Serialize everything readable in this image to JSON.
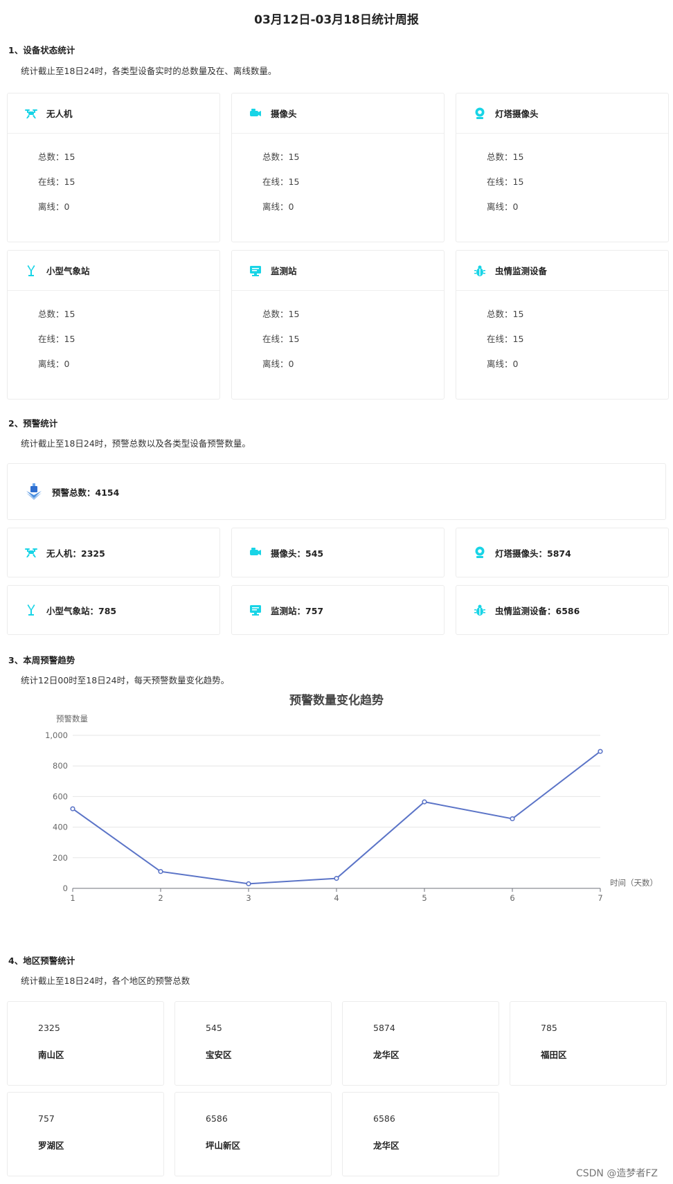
{
  "title": "03月12日-03月18日统计周报",
  "section1": {
    "heading": "1、设备状态统计",
    "desc": "统计截止至18日24时，各类型设备实时的总数量及在、离线数量。",
    "devices": [
      {
        "name": "无人机",
        "icon": "drone-icon",
        "total": "总数：15",
        "online": "在线：15",
        "offline": "离线：0"
      },
      {
        "name": "摄像头",
        "icon": "camera-icon",
        "total": "总数：15",
        "online": "在线：15",
        "offline": "离线：0"
      },
      {
        "name": "灯塔摄像头",
        "icon": "tower-camera-icon",
        "total": "总数：15",
        "online": "在线：15",
        "offline": "离线：0"
      },
      {
        "name": "小型气象站",
        "icon": "weather-station-icon",
        "total": "总数：15",
        "online": "在线：15",
        "offline": "离线：0"
      },
      {
        "name": "监测站",
        "icon": "monitor-station-icon",
        "total": "总数：15",
        "online": "在线：15",
        "offline": "离线：0"
      },
      {
        "name": "虫情监测设备",
        "icon": "bug-monitor-icon",
        "total": "总数：15",
        "online": "在线：15",
        "offline": "离线：0"
      }
    ]
  },
  "section2": {
    "heading": "2、预警统计",
    "desc": "统计截止至18日24时，预警总数以及各类型设备预警数量。",
    "total_label": "预警总数：4154",
    "items": [
      {
        "label": "无人机：2325",
        "icon": "drone-icon"
      },
      {
        "label": "摄像头：545",
        "icon": "camera-icon"
      },
      {
        "label": "灯塔摄像头：5874",
        "icon": "tower-camera-icon"
      },
      {
        "label": "小型气象站：785",
        "icon": "weather-station-icon"
      },
      {
        "label": "监测站：757",
        "icon": "monitor-station-icon"
      },
      {
        "label": "虫情监测设备：6586",
        "icon": "bug-monitor-icon"
      }
    ]
  },
  "section3": {
    "heading": "3、本周预警趋势",
    "desc": "统计12日00时至18日24时，每天预警数量变化趋势。"
  },
  "chart_data": {
    "type": "line",
    "title": "预警数量变化趋势",
    "ylabel": "预警数量",
    "xlabel": "时间（天数）",
    "categories": [
      "1",
      "2",
      "3",
      "4",
      "5",
      "6",
      "7"
    ],
    "values": [
      520,
      110,
      30,
      65,
      565,
      455,
      895
    ],
    "ylim": [
      0,
      1000
    ],
    "yticks": [
      "0",
      "200",
      "400",
      "600",
      "800",
      "1,000"
    ],
    "grid": true,
    "color": "#5b74c7"
  },
  "section4": {
    "heading": "4、地区预警统计",
    "desc": "统计截止至18日24时，各个地区的预警总数",
    "regions": [
      {
        "num": "2325",
        "name": "南山区"
      },
      {
        "num": "545",
        "name": "宝安区"
      },
      {
        "num": "5874",
        "name": "龙华区"
      },
      {
        "num": "785",
        "name": "福田区"
      },
      {
        "num": "757",
        "name": "罗湖区"
      },
      {
        "num": "6586",
        "name": "坪山新区"
      },
      {
        "num": "6586",
        "name": "龙华区"
      }
    ]
  },
  "watermark": "CSDN @造梦者FZ",
  "colors": {
    "accent": "#18d4e6",
    "line": "#5b74c7"
  }
}
